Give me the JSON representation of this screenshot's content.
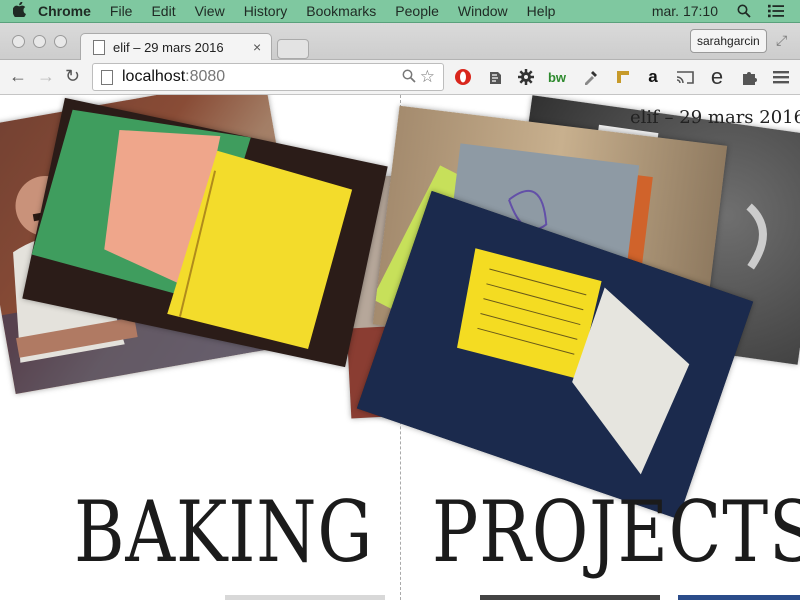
{
  "menubar": {
    "apple": "",
    "app": "Chrome",
    "items": [
      "File",
      "Edit",
      "View",
      "History",
      "Bookmarks",
      "People",
      "Window",
      "Help"
    ],
    "clock": "mar. 17:10"
  },
  "browser": {
    "tab_title": "elif – 29 mars 2016",
    "profile": "sarahgarcin",
    "url_host": "localhost",
    "url_port": ":8080"
  },
  "page": {
    "title": "elif – 29 mars 2016",
    "left_heading": "BAKING",
    "right_heading": "PROJECTS"
  },
  "colors": {
    "menubar": "#7fc8a0",
    "notebook_yellow": "#f3dc2b",
    "notebook_pink": "#f2a58a",
    "notebook_green": "#3a9a5b",
    "opera_red": "#d9261c"
  }
}
